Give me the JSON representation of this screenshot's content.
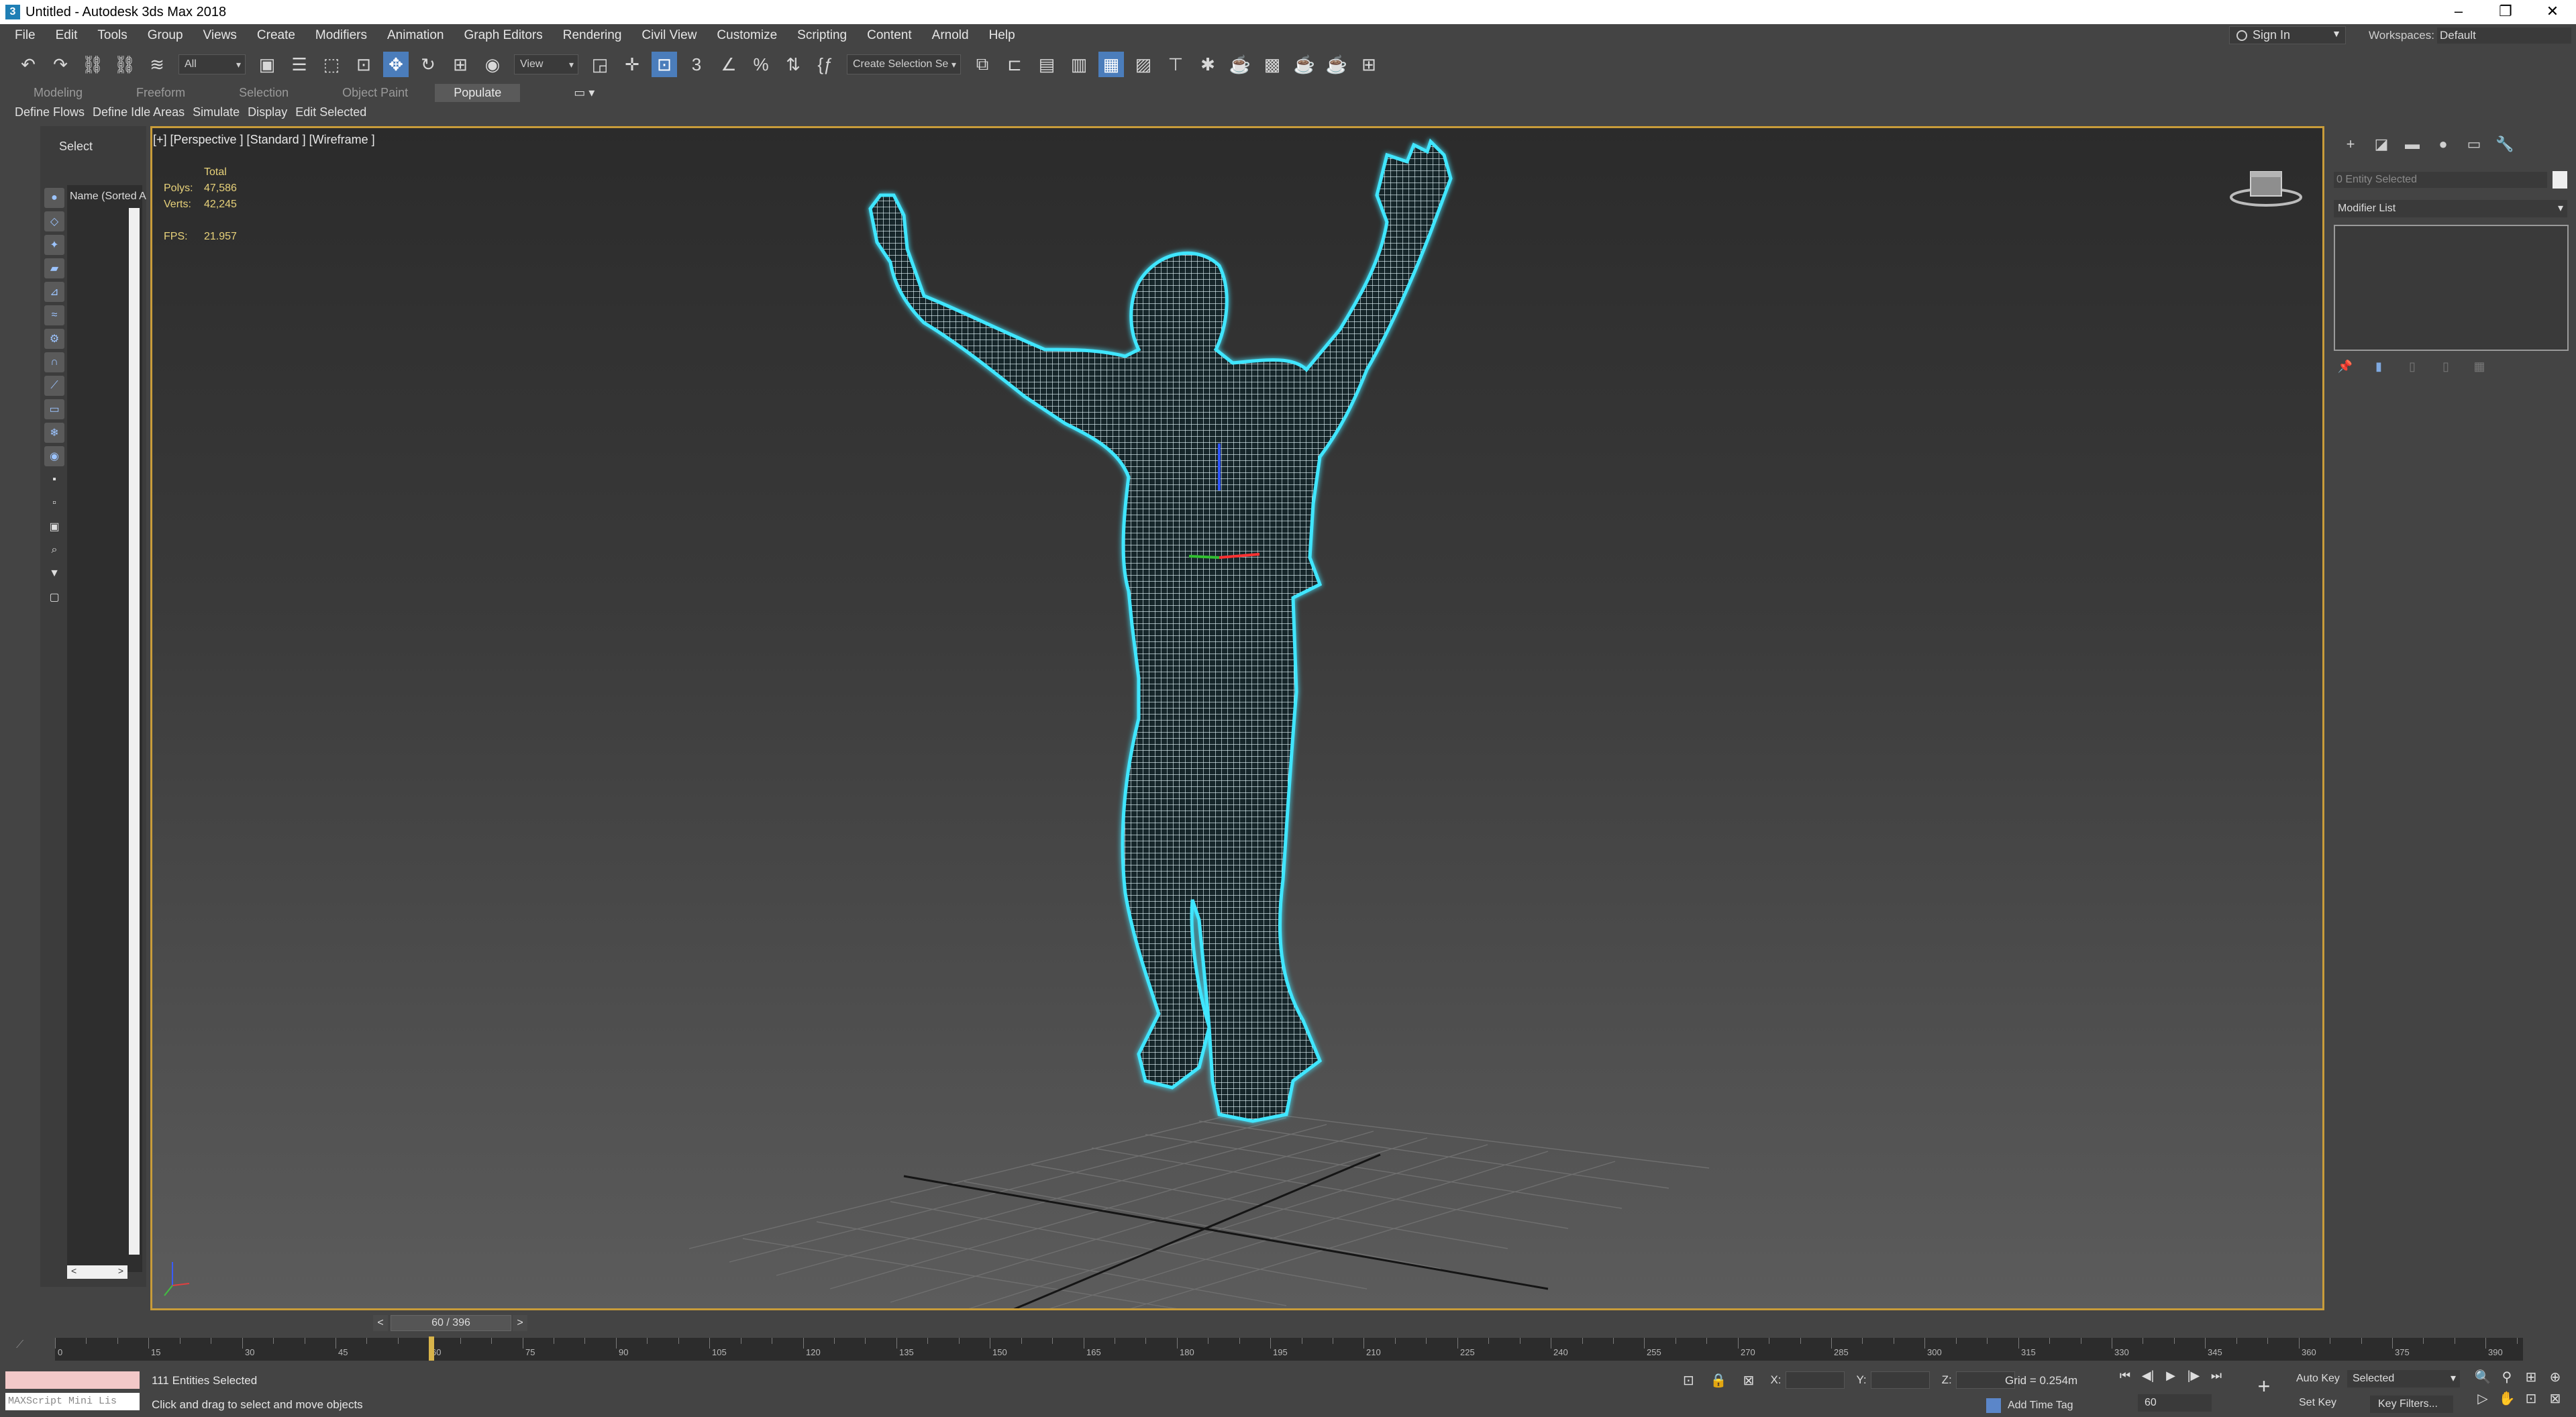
{
  "window": {
    "title": "Untitled - Autodesk 3ds Max 2018",
    "app_icon": "3",
    "controls": [
      "minimize-icon",
      "restore-icon",
      "close-icon"
    ],
    "minimize_glyph": "–",
    "restore_glyph": "❐",
    "close_glyph": "✕"
  },
  "menu": {
    "items": [
      "File",
      "Edit",
      "Tools",
      "Group",
      "Views",
      "Create",
      "Modifiers",
      "Animation",
      "Graph Editors",
      "Rendering",
      "Civil View",
      "Customize",
      "Scripting",
      "Content",
      "Arnold",
      "Help"
    ],
    "sign_in": "Sign In",
    "workspaces_label": "Workspaces:",
    "workspaces_value": "Default"
  },
  "toolbar": {
    "filter_value": "All",
    "ref_coord_value": "View",
    "selection_set_placeholder": "Create Selection Se",
    "undo_glyph": "↶",
    "redo_glyph": "↷",
    "link_glyph": "⛓",
    "unlink_glyph": "⛓",
    "bind_glyph": "≋",
    "select_obj_glyph": "▣",
    "select_name_glyph": "☰",
    "rect_sel_glyph": "⬚",
    "window_glyph": "⊡",
    "move_glyph": "✥",
    "rotate_glyph": "↻",
    "scale_glyph": "⊞",
    "place_glyph": "◉",
    "pivot_glyph": "◲",
    "manip_glyph": "✛",
    "keymode_glyph": "⊡",
    "snap_glyph": "3",
    "angle_glyph": "∠",
    "percent_glyph": "%",
    "spinner_glyph": "⇅",
    "edit_named_glyph": "{ƒ",
    "mirror_glyph": "⧉",
    "align_glyph": "⊏",
    "layer_glyph": "▤",
    "toggle_explorer_glyph": "▥",
    "ribbon_glyph": "▦",
    "curve_glyph": "▨",
    "schematic_glyph": "⊤",
    "material_glyph": "✱",
    "render_setup_glyph": "☕",
    "render_frame_glyph": "▩",
    "render_glyph": "☕",
    "render_iter_glyph": "☕",
    "a360_glyph": "⊞"
  },
  "ribbon": {
    "tabs": [
      "Modeling",
      "Freeform",
      "Selection",
      "Object Paint",
      "Populate"
    ],
    "active_tab": "Populate",
    "panel_toggle": "▭ ▾",
    "sub_items": [
      "Define Flows",
      "Define Idle Areas",
      "Simulate",
      "Display",
      "Edit Selected"
    ]
  },
  "scene_explorer": {
    "header": "Select",
    "column_label": "Name (Sorted A",
    "scroll_left": "<",
    "scroll_right": ">"
  },
  "viewport": {
    "label": "[+] [Perspective ] [Standard ] [Wireframe ]",
    "stats": {
      "total_label": "Total",
      "polys_label": "Polys:",
      "polys_value": "47,586",
      "verts_label": "Verts:",
      "verts_value": "42,245",
      "fps_label": "FPS:",
      "fps_value": "21.957"
    },
    "wire_color": "#aef4ff",
    "outline_color": "#3fe6ff",
    "active_border_color": "#c89c3a"
  },
  "command_panel": {
    "tab_glyphs": [
      "+",
      "◪",
      "▬",
      "●",
      "▭",
      "🔧"
    ],
    "entity_selected": "0 Entity Selected",
    "modifier_list": "Modifier List",
    "stack_tools": [
      "📌",
      "▮",
      "▯",
      "▯",
      "▦"
    ]
  },
  "timeline": {
    "frame_display": "60 / 396",
    "prev": "<",
    "next": ">",
    "current_frame": 60,
    "total_frames": 396,
    "tick_labels": [
      "0",
      "15",
      "30",
      "45",
      "60",
      "75",
      "90",
      "105",
      "120",
      "135",
      "150",
      "165",
      "180",
      "195",
      "210",
      "225",
      "240",
      "255",
      "270",
      "285",
      "300",
      "315",
      "330",
      "345",
      "360",
      "375",
      "390"
    ]
  },
  "status": {
    "maxscript_placeholder": "MAXScript Mini Lis",
    "entities_selected": "111 Entities Selected",
    "prompt": "Click and drag to select and move objects",
    "x_label": "X:",
    "y_label": "Y:",
    "z_label": "Z:",
    "grid": "Grid = 0.254m",
    "add_time_tag": "Add Time Tag",
    "frame_value": "60",
    "auto_key": "Auto Key",
    "set_key": "Set Key",
    "selected_dropdown": "Selected",
    "key_filters": "Key Filters...",
    "playback_glyphs": [
      "⏮",
      "◀|",
      "▶",
      "|▶",
      "⏭"
    ],
    "keymode_glyph": "+",
    "nav_glyphs": [
      "🔍",
      "⚲",
      "⊞",
      "⊕",
      "▷",
      "✋",
      "⊡",
      "⊠"
    ]
  }
}
